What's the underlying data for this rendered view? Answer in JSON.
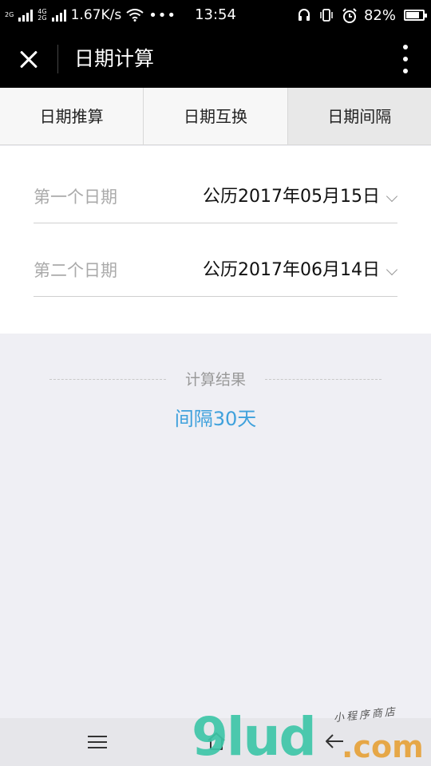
{
  "status_bar": {
    "net_tag_top": "2G",
    "net_tag_mid": "4G",
    "net_tag_bot": "2G",
    "speed": "1.67K/s",
    "dots": "•••",
    "time": "13:54",
    "battery": "82%",
    "battery_level": 0.82
  },
  "titlebar": {
    "title": "日期计算"
  },
  "tabs": [
    {
      "label": "日期推算",
      "active": false
    },
    {
      "label": "日期互换",
      "active": false
    },
    {
      "label": "日期间隔",
      "active": true
    }
  ],
  "form": {
    "first": {
      "label": "第一个日期",
      "value": "公历2017年05月15日"
    },
    "second": {
      "label": "第二个日期",
      "value": "公历2017年06月14日"
    }
  },
  "result": {
    "heading": "计算结果",
    "value": "间隔30天"
  },
  "watermark": {
    "brand": "9lud",
    "suffix": ".com",
    "tagline": "小程序商店"
  }
}
